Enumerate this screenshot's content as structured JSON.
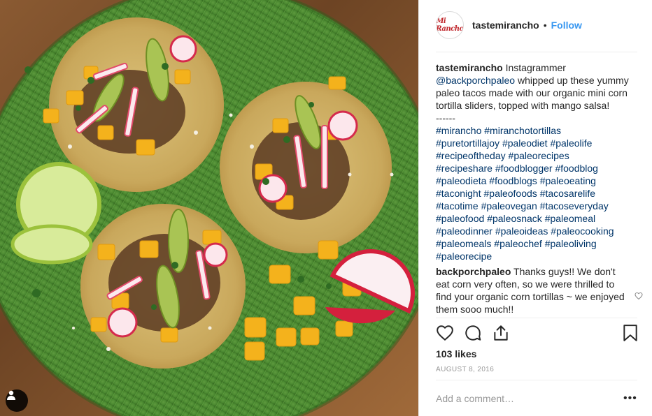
{
  "post": {
    "image_alt": "Mini corn tortilla tacos topped with mango salsa on a green plate",
    "header": {
      "username": "tastemirancho",
      "separator": "•",
      "follow_label": "Follow",
      "avatar_text": "Mi Rancho"
    },
    "caption": {
      "username": "tastemirancho",
      "text_before": "Instagrammer",
      "mention": "@backporchpaleo",
      "text_after": "whipped up these yummy paleo tacos made with our organic mini corn tortilla sliders, topped with mango salsa!",
      "divider": "------",
      "hashtag_lines": [
        [
          "#mirancho",
          "#miranchotortillas"
        ],
        [
          "#puretortillajoy",
          "#paleodiet",
          "#paleolife"
        ],
        [
          "#recipeoftheday",
          "#paleorecipes"
        ],
        [
          "#recipeshare",
          "#foodblogger",
          "#foodblog"
        ],
        [
          "#paleodieta",
          "#foodblogs",
          "#paleoeating"
        ],
        [
          "#taconight",
          "#paleofoods",
          "#tacosarelife"
        ],
        [
          "#tacotime",
          "#paleovegan",
          "#tacoseveryday"
        ],
        [
          "#paleofood",
          "#paleosnack",
          "#paleomeal"
        ],
        [
          "#paleodinner",
          "#paleoideas",
          "#paleocooking"
        ],
        [
          "#paleomeals",
          "#paleochef",
          "#paleoliving"
        ],
        [
          "#paleorecipe"
        ]
      ]
    },
    "comments": [
      {
        "username": "backporchpaleo",
        "text": "Thanks guys!! We don't eat corn very often, so we were thrilled to find your organic corn tortillas ~ we enjoyed them sooo much!!"
      }
    ],
    "actions": {
      "like_icon": "heart-outline-icon",
      "comment_icon": "speech-bubble-icon",
      "share_icon": "share-upload-icon",
      "save_icon": "bookmark-icon"
    },
    "likes": "103 likes",
    "date": "August 8, 2016",
    "add_comment_placeholder": "Add a comment…",
    "more_options": "•••"
  }
}
